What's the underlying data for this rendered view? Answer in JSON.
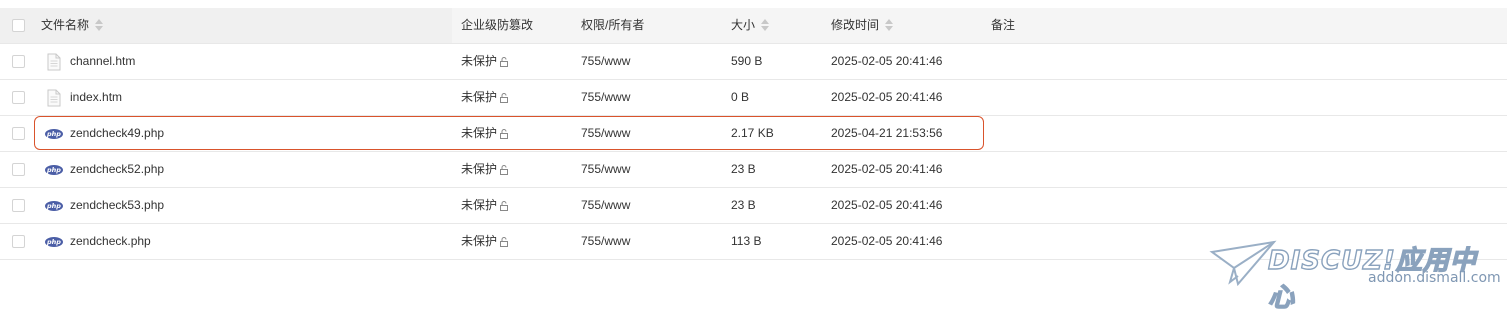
{
  "header": {
    "name": "文件名称",
    "protection": "企业级防篡改",
    "permission": "权限/所有者",
    "size": "大小",
    "modified": "修改时间",
    "note": "备注"
  },
  "rows": [
    {
      "name": "channel.htm",
      "icon": "document-icon",
      "protection": "未保护",
      "permission": "755/www",
      "size": "590 B",
      "modified": "2025-02-05 20:41:46"
    },
    {
      "name": "index.htm",
      "icon": "document-icon",
      "protection": "未保护",
      "permission": "755/www",
      "size": "0 B",
      "modified": "2025-02-05 20:41:46"
    },
    {
      "name": "zendcheck49.php",
      "icon": "php-icon",
      "protection": "未保护",
      "permission": "755/www",
      "size": "2.17 KB",
      "modified": "2025-04-21 21:53:56"
    },
    {
      "name": "zendcheck52.php",
      "icon": "php-icon",
      "protection": "未保护",
      "permission": "755/www",
      "size": "23 B",
      "modified": "2025-02-05 20:41:46"
    },
    {
      "name": "zendcheck53.php",
      "icon": "php-icon",
      "protection": "未保护",
      "permission": "755/www",
      "size": "23 B",
      "modified": "2025-02-05 20:41:46"
    },
    {
      "name": "zendcheck.php",
      "icon": "php-icon",
      "protection": "未保护",
      "permission": "755/www",
      "size": "113 B",
      "modified": "2025-02-05 20:41:46"
    }
  ],
  "watermark": {
    "brand": "DISCUZ!应用中心",
    "url": "addon.dismall.com"
  },
  "colors": {
    "highlight": "#d9532c",
    "php_badge": "#4b5ea6"
  }
}
